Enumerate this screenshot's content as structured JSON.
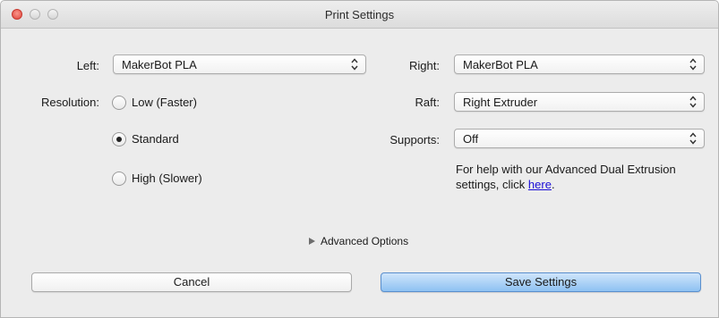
{
  "window": {
    "title": "Print Settings"
  },
  "left_extruder": {
    "label": "Left:",
    "value": "MakerBot PLA"
  },
  "right_extruder": {
    "label": "Right:",
    "value": "MakerBot PLA"
  },
  "resolution": {
    "label": "Resolution:",
    "options": [
      {
        "label": "Low (Faster)",
        "checked": false
      },
      {
        "label": "Standard",
        "checked": true
      },
      {
        "label": "High (Slower)",
        "checked": false
      }
    ]
  },
  "raft": {
    "label": "Raft:",
    "value": "Right Extruder"
  },
  "supports": {
    "label": "Supports:",
    "value": "Off"
  },
  "help": {
    "text": "For help with our Advanced Dual Extrusion settings, click ",
    "link": "here",
    "suffix": "."
  },
  "advanced": {
    "label": "Advanced Options"
  },
  "buttons": {
    "cancel": "Cancel",
    "save": "Save Settings"
  },
  "icons": {
    "traffic_lights": [
      "close-icon",
      "minimize-icon",
      "zoom-icon"
    ],
    "select_arrows": "updown-arrows-icon",
    "disclosure": "disclosure-triangle-icon"
  },
  "colors": {
    "close": "#e0433a",
    "primary_button": "#8ec1f2",
    "link": "#1a0dd6"
  }
}
